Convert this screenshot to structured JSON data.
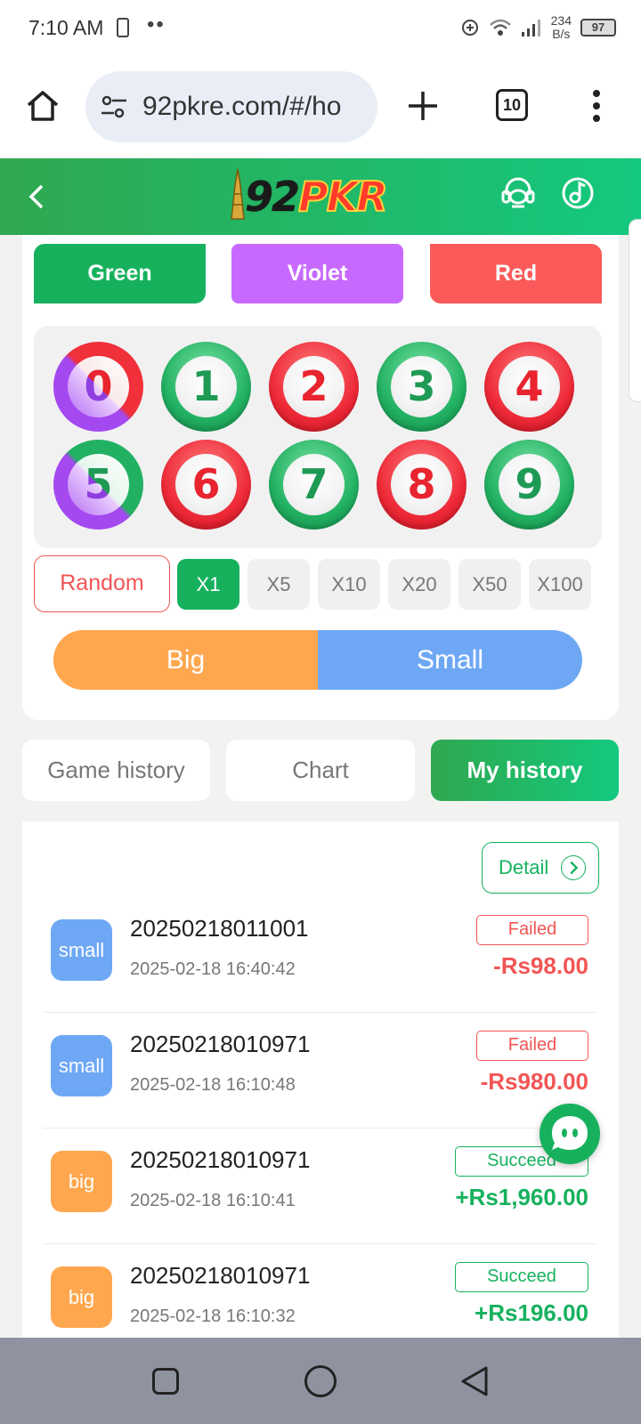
{
  "status_bar": {
    "time": "7:10 AM",
    "dots": "••",
    "net_speed_value": "234",
    "net_speed_unit": "B/s",
    "battery": "97"
  },
  "browser": {
    "url": "92pkre.com/#/ho",
    "tab_count": "10"
  },
  "header": {
    "logo_prefix": "92",
    "logo_suffix": "PKR"
  },
  "colors": [
    {
      "label": "Green",
      "color": "#17b15e"
    },
    {
      "label": "Violet",
      "color": "#c769ff"
    },
    {
      "label": "Red",
      "color": "#fb5a5a"
    }
  ],
  "numbers": [
    {
      "value": "0",
      "style": "red-violet"
    },
    {
      "value": "1",
      "style": "green"
    },
    {
      "value": "2",
      "style": "red"
    },
    {
      "value": "3",
      "style": "green"
    },
    {
      "value": "4",
      "style": "red"
    },
    {
      "value": "5",
      "style": "green-violet"
    },
    {
      "value": "6",
      "style": "red"
    },
    {
      "value": "7",
      "style": "green"
    },
    {
      "value": "8",
      "style": "red"
    },
    {
      "value": "9",
      "style": "green"
    }
  ],
  "random_label": "Random",
  "multipliers": [
    {
      "label": "X1",
      "active": true
    },
    {
      "label": "X5",
      "active": false
    },
    {
      "label": "X10",
      "active": false
    },
    {
      "label": "X20",
      "active": false
    },
    {
      "label": "X50",
      "active": false
    },
    {
      "label": "X100",
      "active": false
    }
  ],
  "big_label": "Big",
  "small_label": "Small",
  "tabs": [
    {
      "label": "Game history",
      "active": false
    },
    {
      "label": "Chart",
      "active": false
    },
    {
      "label": "My history",
      "active": true
    }
  ],
  "detail_label": "Detail",
  "history": [
    {
      "type": "small",
      "period": "20250218011001",
      "time": "2025-02-18 16:40:42",
      "status": "Failed",
      "amount": "-Rs98.00"
    },
    {
      "type": "small",
      "period": "20250218010971",
      "time": "2025-02-18 16:10:48",
      "status": "Failed",
      "amount": "-Rs980.00"
    },
    {
      "type": "big",
      "period": "20250218010971",
      "time": "2025-02-18 16:10:41",
      "status": "Succeed",
      "amount": "+Rs1,960.00"
    },
    {
      "type": "big",
      "period": "20250218010971",
      "time": "2025-02-18 16:10:32",
      "status": "Succeed",
      "amount": "+Rs196.00"
    }
  ]
}
